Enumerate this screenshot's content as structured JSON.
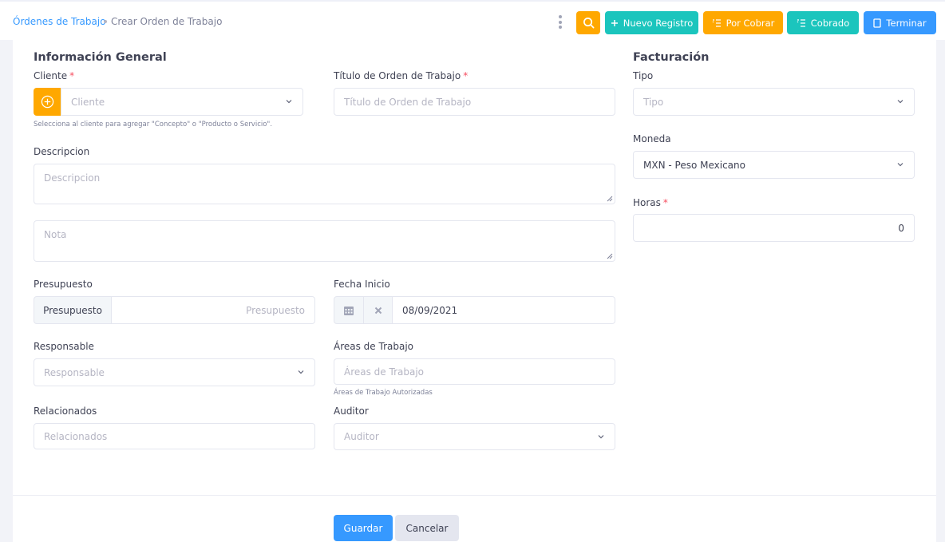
{
  "breadcrumb": {
    "parent": "Órdenes de Trabajo",
    "current": "Crear Orden de Trabajo"
  },
  "toolbar": {
    "search_icon": "search-icon",
    "new_record": "Nuevo Registro",
    "por_cobrar": "Por Cobrar",
    "cobrado": "Cobrado",
    "terminar": "Terminar"
  },
  "general": {
    "title": "Información General",
    "cliente": {
      "label": "Cliente",
      "placeholder": "Cliente",
      "hint": "Selecciona al cliente para agregar \"Concepto\" o \"Producto o Servicio\"."
    },
    "titulo": {
      "label": "Título de Orden de Trabajo",
      "placeholder": "Título de Orden de Trabajo"
    },
    "descripcion": {
      "label": "Descripcion",
      "placeholder": "Descripcion"
    },
    "nota": {
      "placeholder": "Nota"
    },
    "presupuesto": {
      "label": "Presupuesto",
      "addon": "Presupuesto",
      "placeholder": "Presupuesto"
    },
    "fecha_inicio": {
      "label": "Fecha Inicio",
      "value": "08/09/2021"
    },
    "responsable": {
      "label": "Responsable",
      "placeholder": "Responsable"
    },
    "areas": {
      "label": "Áreas de Trabajo",
      "placeholder": "Áreas de Trabajo",
      "hint": "Áreas de Trabajo Autorizadas"
    },
    "relacionados": {
      "label": "Relacionados",
      "placeholder": "Relacionados"
    },
    "auditor": {
      "label": "Auditor",
      "placeholder": "Auditor"
    }
  },
  "billing": {
    "title": "Facturación",
    "tipo": {
      "label": "Tipo",
      "placeholder": "Tipo"
    },
    "moneda": {
      "label": "Moneda",
      "value": "MXN - Peso Mexicano"
    },
    "horas": {
      "label": "Horas",
      "value": "0"
    }
  },
  "footer": {
    "save": "Guardar",
    "cancel": "Cancelar"
  },
  "colors": {
    "primary": "#3699ff",
    "warning": "#ffa800",
    "info": "#1bc5bd",
    "danger": "#f64e60"
  }
}
